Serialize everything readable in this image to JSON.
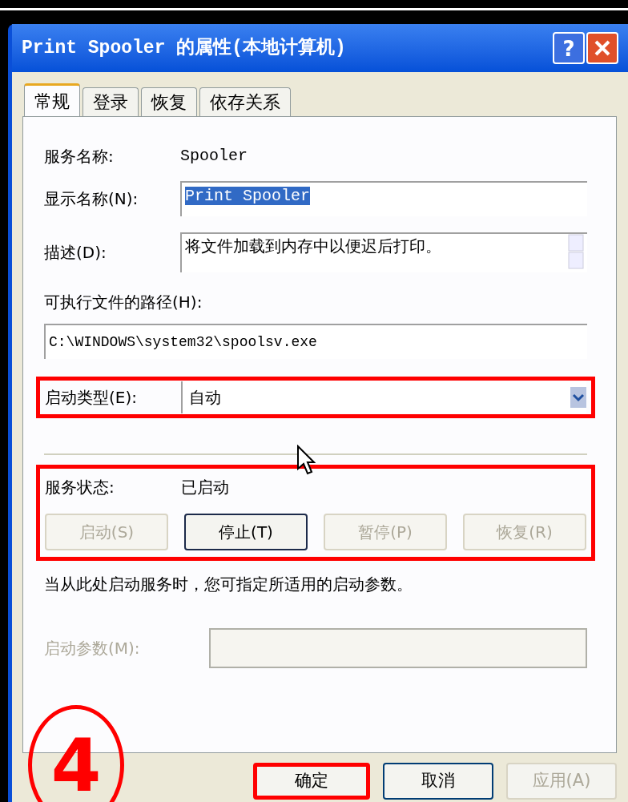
{
  "window": {
    "title": "Print Spooler 的属性(本地计算机)",
    "help_button": "?"
  },
  "tabs": [
    {
      "label": "常规",
      "selected": true
    },
    {
      "label": "登录",
      "selected": false
    },
    {
      "label": "恢复",
      "selected": false
    },
    {
      "label": "依存关系",
      "selected": false
    }
  ],
  "service_name": {
    "label": "服务名称:",
    "value": "Spooler"
  },
  "display_name": {
    "label": "显示名称(N):",
    "value": "Print Spooler",
    "text_selected": true
  },
  "description": {
    "label": "描述(D):",
    "value": "将文件加载到内存中以便迟后打印。"
  },
  "path": {
    "label": "可执行文件的路径(H):",
    "value": "C:\\WINDOWS\\system32\\spoolsv.exe"
  },
  "startup_type": {
    "label": "启动类型(E):",
    "value": "自动",
    "highlighted": true
  },
  "service_status": {
    "label": "服务状态:",
    "value": "已启动",
    "highlighted": true,
    "buttons": [
      {
        "label": "启动(S)",
        "disabled": true,
        "focused": false
      },
      {
        "label": "停止(T)",
        "disabled": false,
        "focused": true
      },
      {
        "label": "暂停(P)",
        "disabled": true,
        "focused": false
      },
      {
        "label": "恢复(R)",
        "disabled": true,
        "focused": false
      }
    ]
  },
  "hint": "当从此处启动服务时，您可指定所适用的启动参数。",
  "start_parameters": {
    "label": "启动参数(M):",
    "disabled": true
  },
  "step_marker": "4",
  "dialog_buttons": [
    {
      "label": "确定",
      "disabled": false,
      "highlighted": true
    },
    {
      "label": "取消",
      "disabled": false,
      "highlighted": false
    },
    {
      "label": "应用(A)",
      "disabled": true,
      "highlighted": false
    }
  ]
}
